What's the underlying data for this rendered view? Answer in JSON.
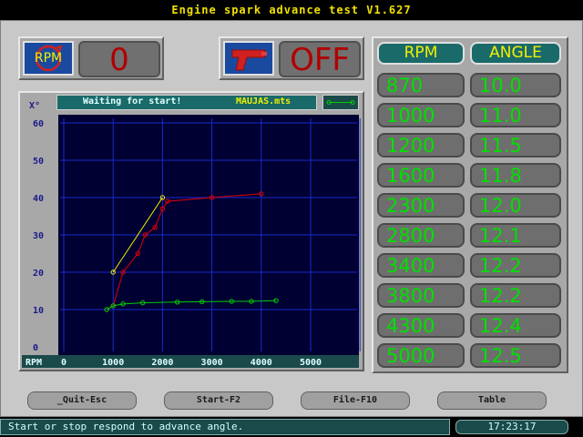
{
  "window": {
    "title": "Engine spark advance test  V1.627"
  },
  "rpm_indicator": {
    "icon_label": "RPM",
    "value": "0"
  },
  "trigger_indicator": {
    "state": "OFF"
  },
  "plot_header": {
    "status": "Waiting for start!",
    "filename": "MAUJAS.mts"
  },
  "table": {
    "headers": {
      "rpm": "RPM",
      "angle": "ANGLE"
    },
    "rows": [
      {
        "rpm": "870",
        "angle": "10.0"
      },
      {
        "rpm": "1000",
        "angle": "11.0"
      },
      {
        "rpm": "1200",
        "angle": "11.5"
      },
      {
        "rpm": "1600",
        "angle": "11.8"
      },
      {
        "rpm": "2300",
        "angle": "12.0"
      },
      {
        "rpm": "2800",
        "angle": "12.1"
      },
      {
        "rpm": "3400",
        "angle": "12.2"
      },
      {
        "rpm": "3800",
        "angle": "12.2"
      },
      {
        "rpm": "4300",
        "angle": "12.4"
      },
      {
        "rpm": "5000",
        "angle": "12.5"
      }
    ]
  },
  "buttons": {
    "quit": "_Quit-Esc",
    "start": "Start-F2",
    "file": "File-F10",
    "table": "Table"
  },
  "status_bar": {
    "message": "Start or stop respond to advance angle.",
    "time": "17:23:17"
  },
  "colors": {
    "background": "#000000",
    "plot_bg": "#000033",
    "grid": "#1a2acc",
    "series_red": "#e00000",
    "series_yellow": "#f0f000",
    "series_green": "#00d000",
    "value_green": "#00e000",
    "header_yellow": "#f0f000"
  },
  "chart_data": {
    "type": "line",
    "ylabel": "X°",
    "xlabel": "RPM",
    "x_ticks": [
      "0",
      "1000",
      "2000",
      "3000",
      "4000",
      "5000"
    ],
    "y_ticks": [
      "0",
      "10",
      "20",
      "30",
      "40",
      "50",
      "60"
    ],
    "xlim": [
      0,
      6000
    ],
    "ylim": [
      0,
      60
    ],
    "grid": true,
    "series": [
      {
        "color": "#e00000",
        "points": [
          [
            870,
            10
          ],
          [
            1000,
            11
          ],
          [
            1200,
            20
          ],
          [
            1500,
            25
          ],
          [
            1650,
            30
          ],
          [
            1850,
            32
          ],
          [
            2000,
            37
          ],
          [
            2100,
            39
          ],
          [
            3000,
            40
          ],
          [
            4000,
            41
          ]
        ]
      },
      {
        "color": "#f0f000",
        "points": [
          [
            1000,
            20
          ],
          [
            2000,
            40
          ]
        ]
      },
      {
        "color": "#00d000",
        "points": [
          [
            870,
            10
          ],
          [
            1000,
            11
          ],
          [
            1200,
            11.5
          ],
          [
            1600,
            11.8
          ],
          [
            2300,
            12.0
          ],
          [
            2800,
            12.1
          ],
          [
            3400,
            12.2
          ],
          [
            3800,
            12.2
          ],
          [
            4300,
            12.4
          ]
        ]
      }
    ]
  }
}
